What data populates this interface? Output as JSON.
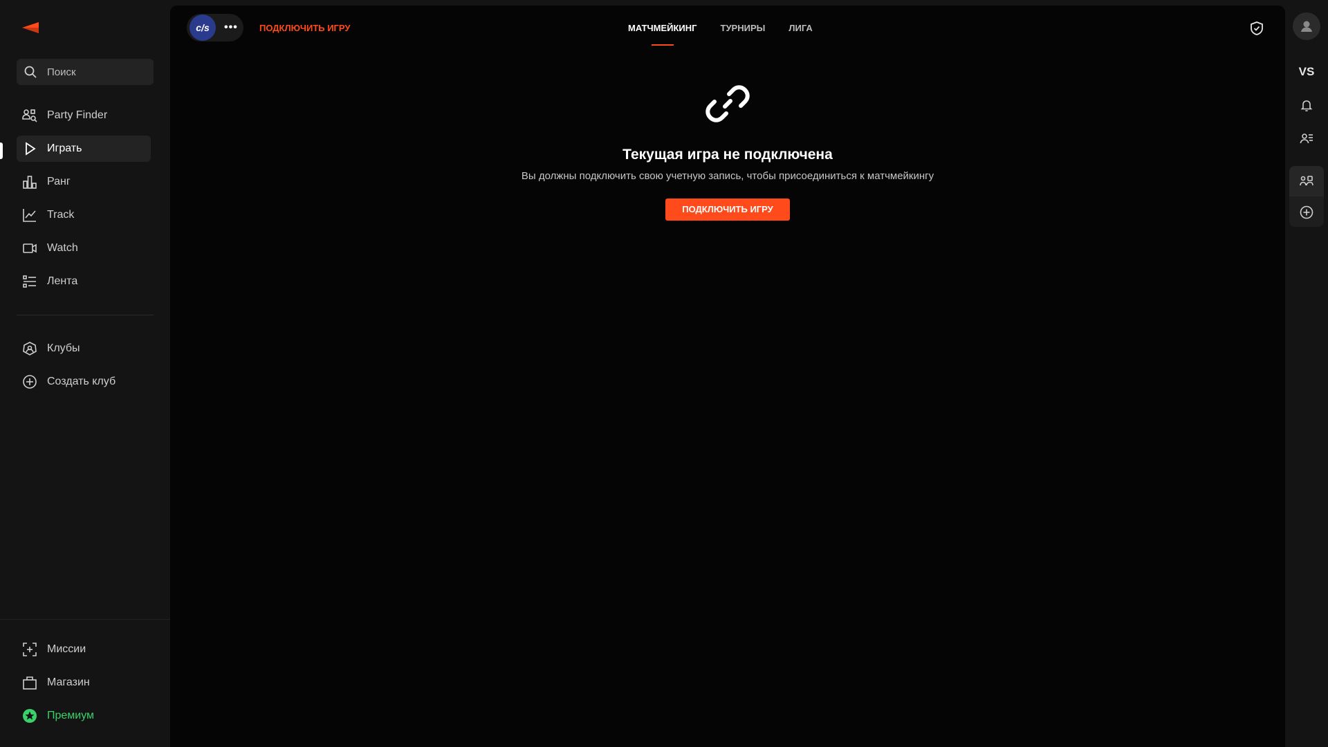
{
  "brand": {
    "accent_color": "#ff4a1c",
    "premium_color": "#3ad16a"
  },
  "sidebar": {
    "search_placeholder": "Поиск",
    "items": [
      {
        "label": "Party Finder",
        "icon": "party-finder-icon"
      },
      {
        "label": "Играть",
        "icon": "play-icon",
        "active": true
      },
      {
        "label": "Ранг",
        "icon": "rank-icon"
      },
      {
        "label": "Track",
        "icon": "track-icon"
      },
      {
        "label": "Watch",
        "icon": "watch-icon"
      },
      {
        "label": "Лента",
        "icon": "feed-icon"
      }
    ],
    "club_items": [
      {
        "label": "Клубы",
        "icon": "clubs-icon"
      },
      {
        "label": "Создать клуб",
        "icon": "add-circle-icon"
      }
    ],
    "bottom_items": [
      {
        "label": "Миссии",
        "icon": "missions-icon"
      },
      {
        "label": "Магазин",
        "icon": "shop-icon"
      },
      {
        "label": "Премиум",
        "icon": "premium-icon"
      }
    ]
  },
  "header": {
    "game_logo_text": "c/s",
    "more_label": "•••",
    "connect_link": "ПОДКЛЮЧИТЬ ИГРУ",
    "tabs": [
      "МАТЧМЕЙКИНГ",
      "ТУРНИРЫ",
      "ЛИГА"
    ],
    "active_tab": "МАТЧМЕЙКИНГ"
  },
  "empty_state": {
    "title": "Текущая игра не подключена",
    "subtitle": "Вы должны подключить свою учетную запись, чтобы присоединиться к матчмейкингу",
    "button_label": "ПОДКЛЮЧИТЬ ИГРУ"
  },
  "rail": {
    "vs_label": "VS"
  }
}
